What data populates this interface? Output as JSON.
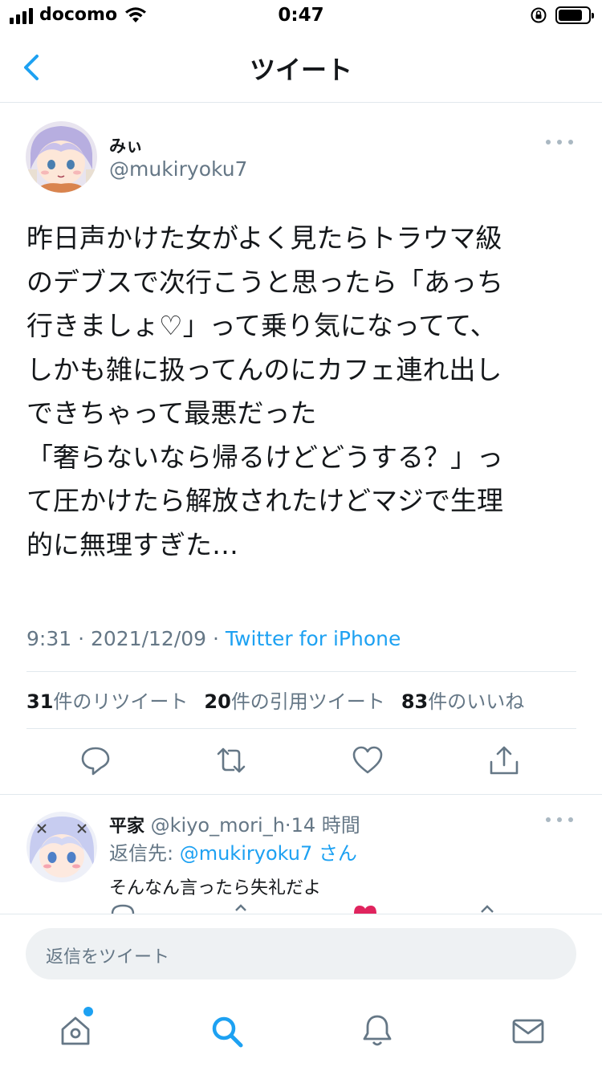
{
  "status_bar": {
    "carrier": "docomo",
    "time": "0:47"
  },
  "nav": {
    "title": "ツイート"
  },
  "tweet": {
    "display_name": "みぃ",
    "handle": "@mukiryoku7",
    "text": "昨日声かけた女がよく見たらトラウマ級\nのデブスで次行こうと思ったら「あっち\n行きましょ♡」って乗り気になってて、\nしかも雑に扱ってんのにカフェ連れ出し\nできちゃって最悪だった\n「奢らないなら帰るけどどうする？」っ\nて圧かけたら解放されたけどマジで生理\n的に無理すぎた…",
    "time": "9:31",
    "sep1": " · ",
    "date": "2021/12/09",
    "sep2": " · ",
    "source": "Twitter for iPhone",
    "stats": {
      "retweets_count": "31",
      "retweets_label": "件のリツイート",
      "quotes_count": "20",
      "quotes_label": "件の引用ツイート",
      "likes_count": "83",
      "likes_label": "件のいいね"
    }
  },
  "reply": {
    "display_name": "平家",
    "handle": "@kiyo_mori_h",
    "sep": "·",
    "age": "14 時間",
    "reply_to_prefix": "返信先: ",
    "reply_to_handle": "@mukiryoku7",
    "reply_to_suffix": " さん",
    "text": "そんなん言ったら失礼だよ"
  },
  "composer": {
    "placeholder": "返信をツイート"
  },
  "colors": {
    "accent": "#1da1f2",
    "secondary_text": "#657786",
    "like_pink": "#e0245e"
  },
  "icons": [
    "back-chevron-icon",
    "more-icon",
    "reply-icon",
    "retweet-icon",
    "like-icon",
    "share-icon",
    "home-icon",
    "search-icon",
    "notifications-icon",
    "messages-icon"
  ]
}
